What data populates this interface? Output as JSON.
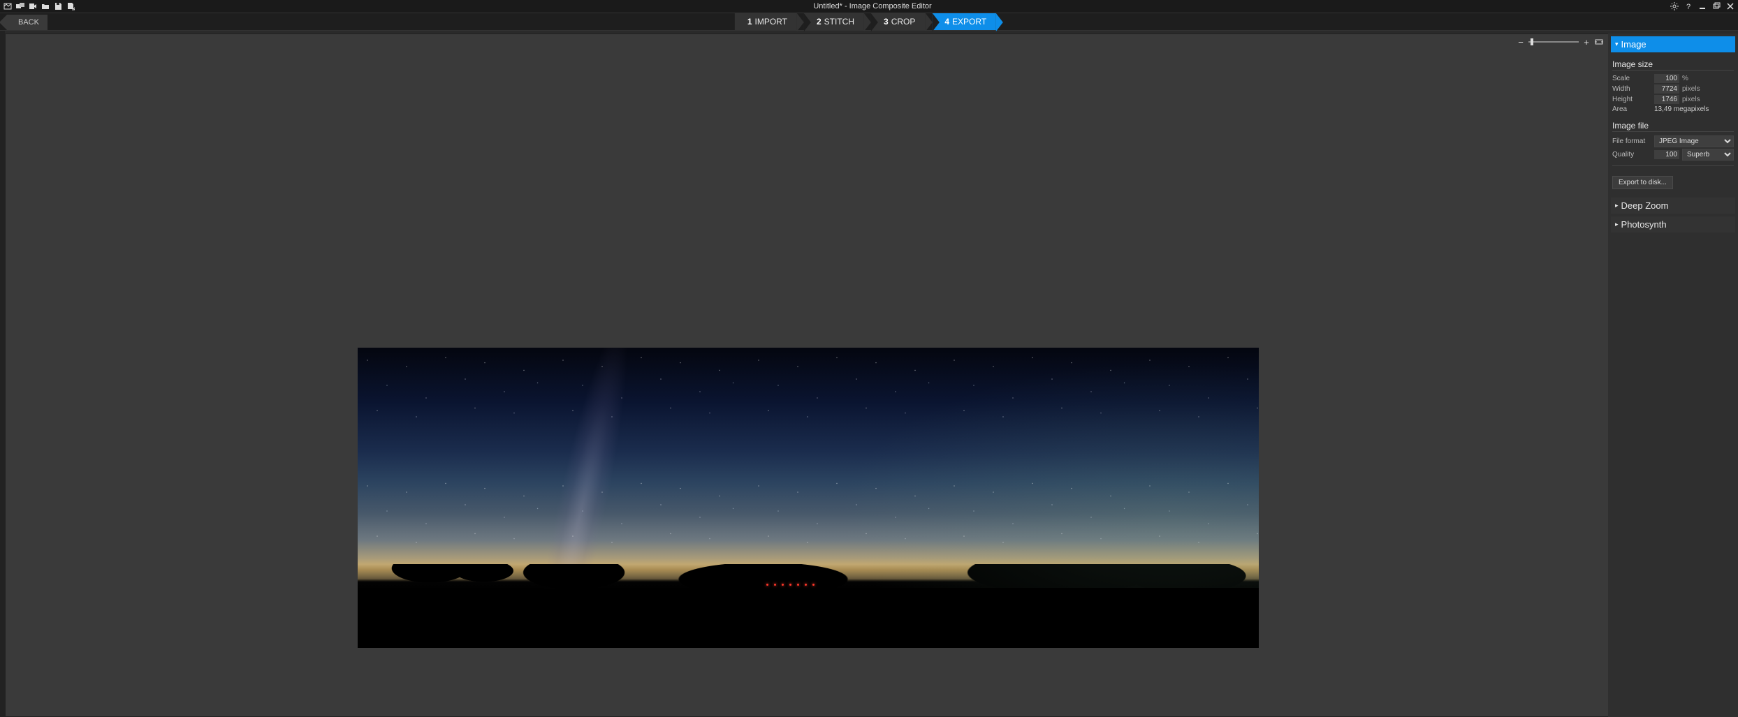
{
  "window": {
    "title": "Untitled* - Image Composite Editor"
  },
  "steps": {
    "back": "BACK",
    "items": [
      {
        "num": "1",
        "label": "IMPORT"
      },
      {
        "num": "2",
        "label": "STITCH"
      },
      {
        "num": "3",
        "label": "CROP"
      },
      {
        "num": "4",
        "label": "EXPORT"
      }
    ],
    "activeIndex": 3
  },
  "panels": {
    "image": {
      "title": "Image",
      "groups": {
        "size": {
          "title": "Image size",
          "scale": {
            "label": "Scale",
            "value": "100",
            "unit": "%"
          },
          "width": {
            "label": "Width",
            "value": "7724",
            "unit": "pixels"
          },
          "height": {
            "label": "Height",
            "value": "1746",
            "unit": "pixels"
          },
          "area": {
            "label": "Area",
            "value": "13,49 megapixels"
          }
        },
        "file": {
          "title": "Image file",
          "format": {
            "label": "File format",
            "value": "JPEG Image"
          },
          "quality": {
            "label": "Quality",
            "value": "100",
            "preset": "Superb"
          }
        }
      },
      "export_btn": "Export to disk..."
    },
    "deepzoom": {
      "title": "Deep Zoom"
    },
    "photosynth": {
      "title": "Photosynth"
    }
  },
  "icons": {
    "new_pano": "new-panorama-icon",
    "new_images": "new-from-images-icon",
    "new_video": "new-from-video-icon",
    "open": "open-icon",
    "save": "save-icon",
    "save_as": "save-as-icon",
    "settings": "gear-icon",
    "help": "help-icon",
    "minimize": "minimize-icon",
    "maximize": "maximize-icon",
    "close": "close-icon",
    "zoom_out": "minus-icon",
    "zoom_in": "plus-icon",
    "fit": "fit-view-icon"
  }
}
